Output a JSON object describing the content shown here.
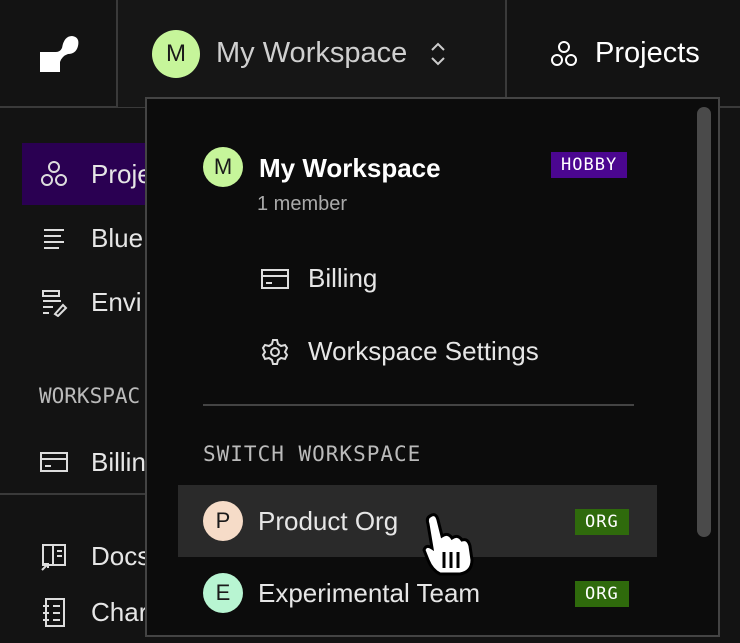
{
  "header": {
    "workspace_name": "My Workspace",
    "workspace_initial": "M",
    "projects_label": "Projects"
  },
  "sidebar": {
    "items": [
      {
        "label": "Proje",
        "icon": "hexagons-icon",
        "selected": true
      },
      {
        "label": "Blue",
        "icon": "lines-icon"
      },
      {
        "label": "Envi",
        "icon": "env-icon"
      }
    ],
    "section_label": "WORKSPAC",
    "billing": "Billin",
    "docs": "Docs",
    "changelog": "Char"
  },
  "dropdown": {
    "current": {
      "initial": "M",
      "name": "My Workspace",
      "members": "1 member",
      "badge": "HOBBY"
    },
    "billing": "Billing",
    "settings": "Workspace Settings",
    "switch_label": "SWITCH WORKSPACE",
    "workspaces": [
      {
        "initial": "P",
        "name": "Product Org",
        "badge": "ORG",
        "color": "#f6dcc8"
      },
      {
        "initial": "E",
        "name": "Experimental Team",
        "badge": "ORG",
        "color": "#b8f5d2"
      }
    ]
  },
  "colors": {
    "accent_green": "#c6f59a",
    "hobby": "#4b0690",
    "org": "#2f6a0c",
    "selected": "#2a0052"
  }
}
